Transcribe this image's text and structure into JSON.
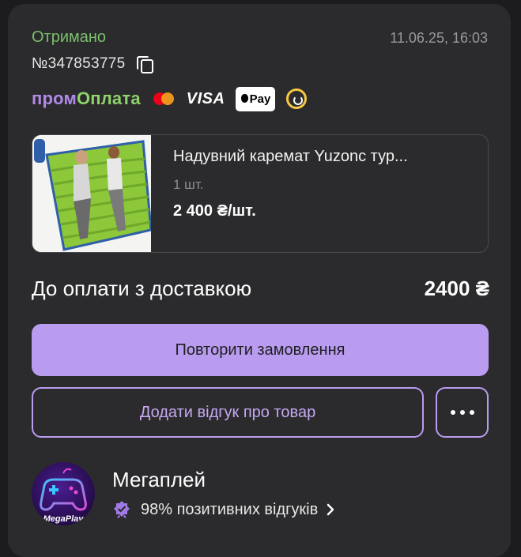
{
  "order": {
    "status": "Отримано",
    "datetime": "11.06.25, 16:03",
    "number": "№347853775"
  },
  "payment": {
    "brand_part1": "пром",
    "brand_part2": "Оплата",
    "visa": "VISA",
    "applepay": "Pay",
    "icons": [
      "mastercard-icon",
      "visa-logo",
      "apple-pay-icon",
      "payment-provider-icon"
    ]
  },
  "product": {
    "name": "Надувний каремат Yuzonc тур...",
    "quantity": "1 шт.",
    "price": "2 400 ₴/шт."
  },
  "total": {
    "label": "До оплати з доставкою",
    "value": "2400 ₴"
  },
  "actions": {
    "repeat_label": "Повторити замовлення",
    "review_label": "Додати відгук про товар"
  },
  "seller": {
    "name": "Мегаплей",
    "rating": "98% позитивних відгуків",
    "avatar_text": "MegaPlay"
  },
  "colors": {
    "background": "#1c1c1e",
    "card": "#2b2b2d",
    "status_green": "#7bbf6a",
    "accent_purple": "#b99cf0",
    "prom_green": "#8fd36a"
  }
}
